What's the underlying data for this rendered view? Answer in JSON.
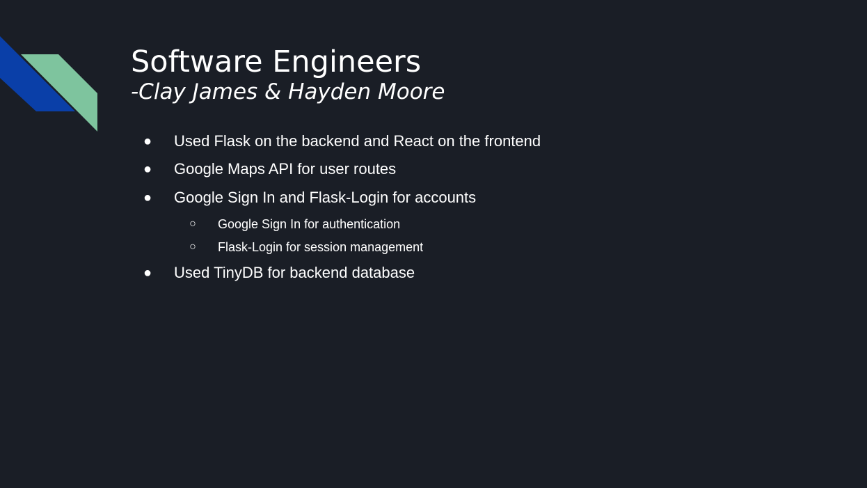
{
  "slide": {
    "title": "Software Engineers",
    "subtitle": "-Clay James & Hayden Moore",
    "bullets": [
      {
        "marker": "●",
        "text": "Used Flask on the backend and React on the frontend"
      },
      {
        "marker": "●",
        "text": "Google Maps API for user routes"
      },
      {
        "marker": "●",
        "text": "Google Sign In and Flask-Login for accounts",
        "sub": [
          {
            "marker": "○",
            "text": "Google Sign In for authentication"
          },
          {
            "marker": "○",
            "text": "Flask-Login for session management"
          }
        ]
      },
      {
        "marker": "●",
        "text": "Used TinyDB for backend database"
      }
    ]
  },
  "colors": {
    "background": "#1a1e26",
    "text": "#ffffff",
    "accent_blue": "#0a3fa8",
    "accent_green": "#7ec49e"
  }
}
